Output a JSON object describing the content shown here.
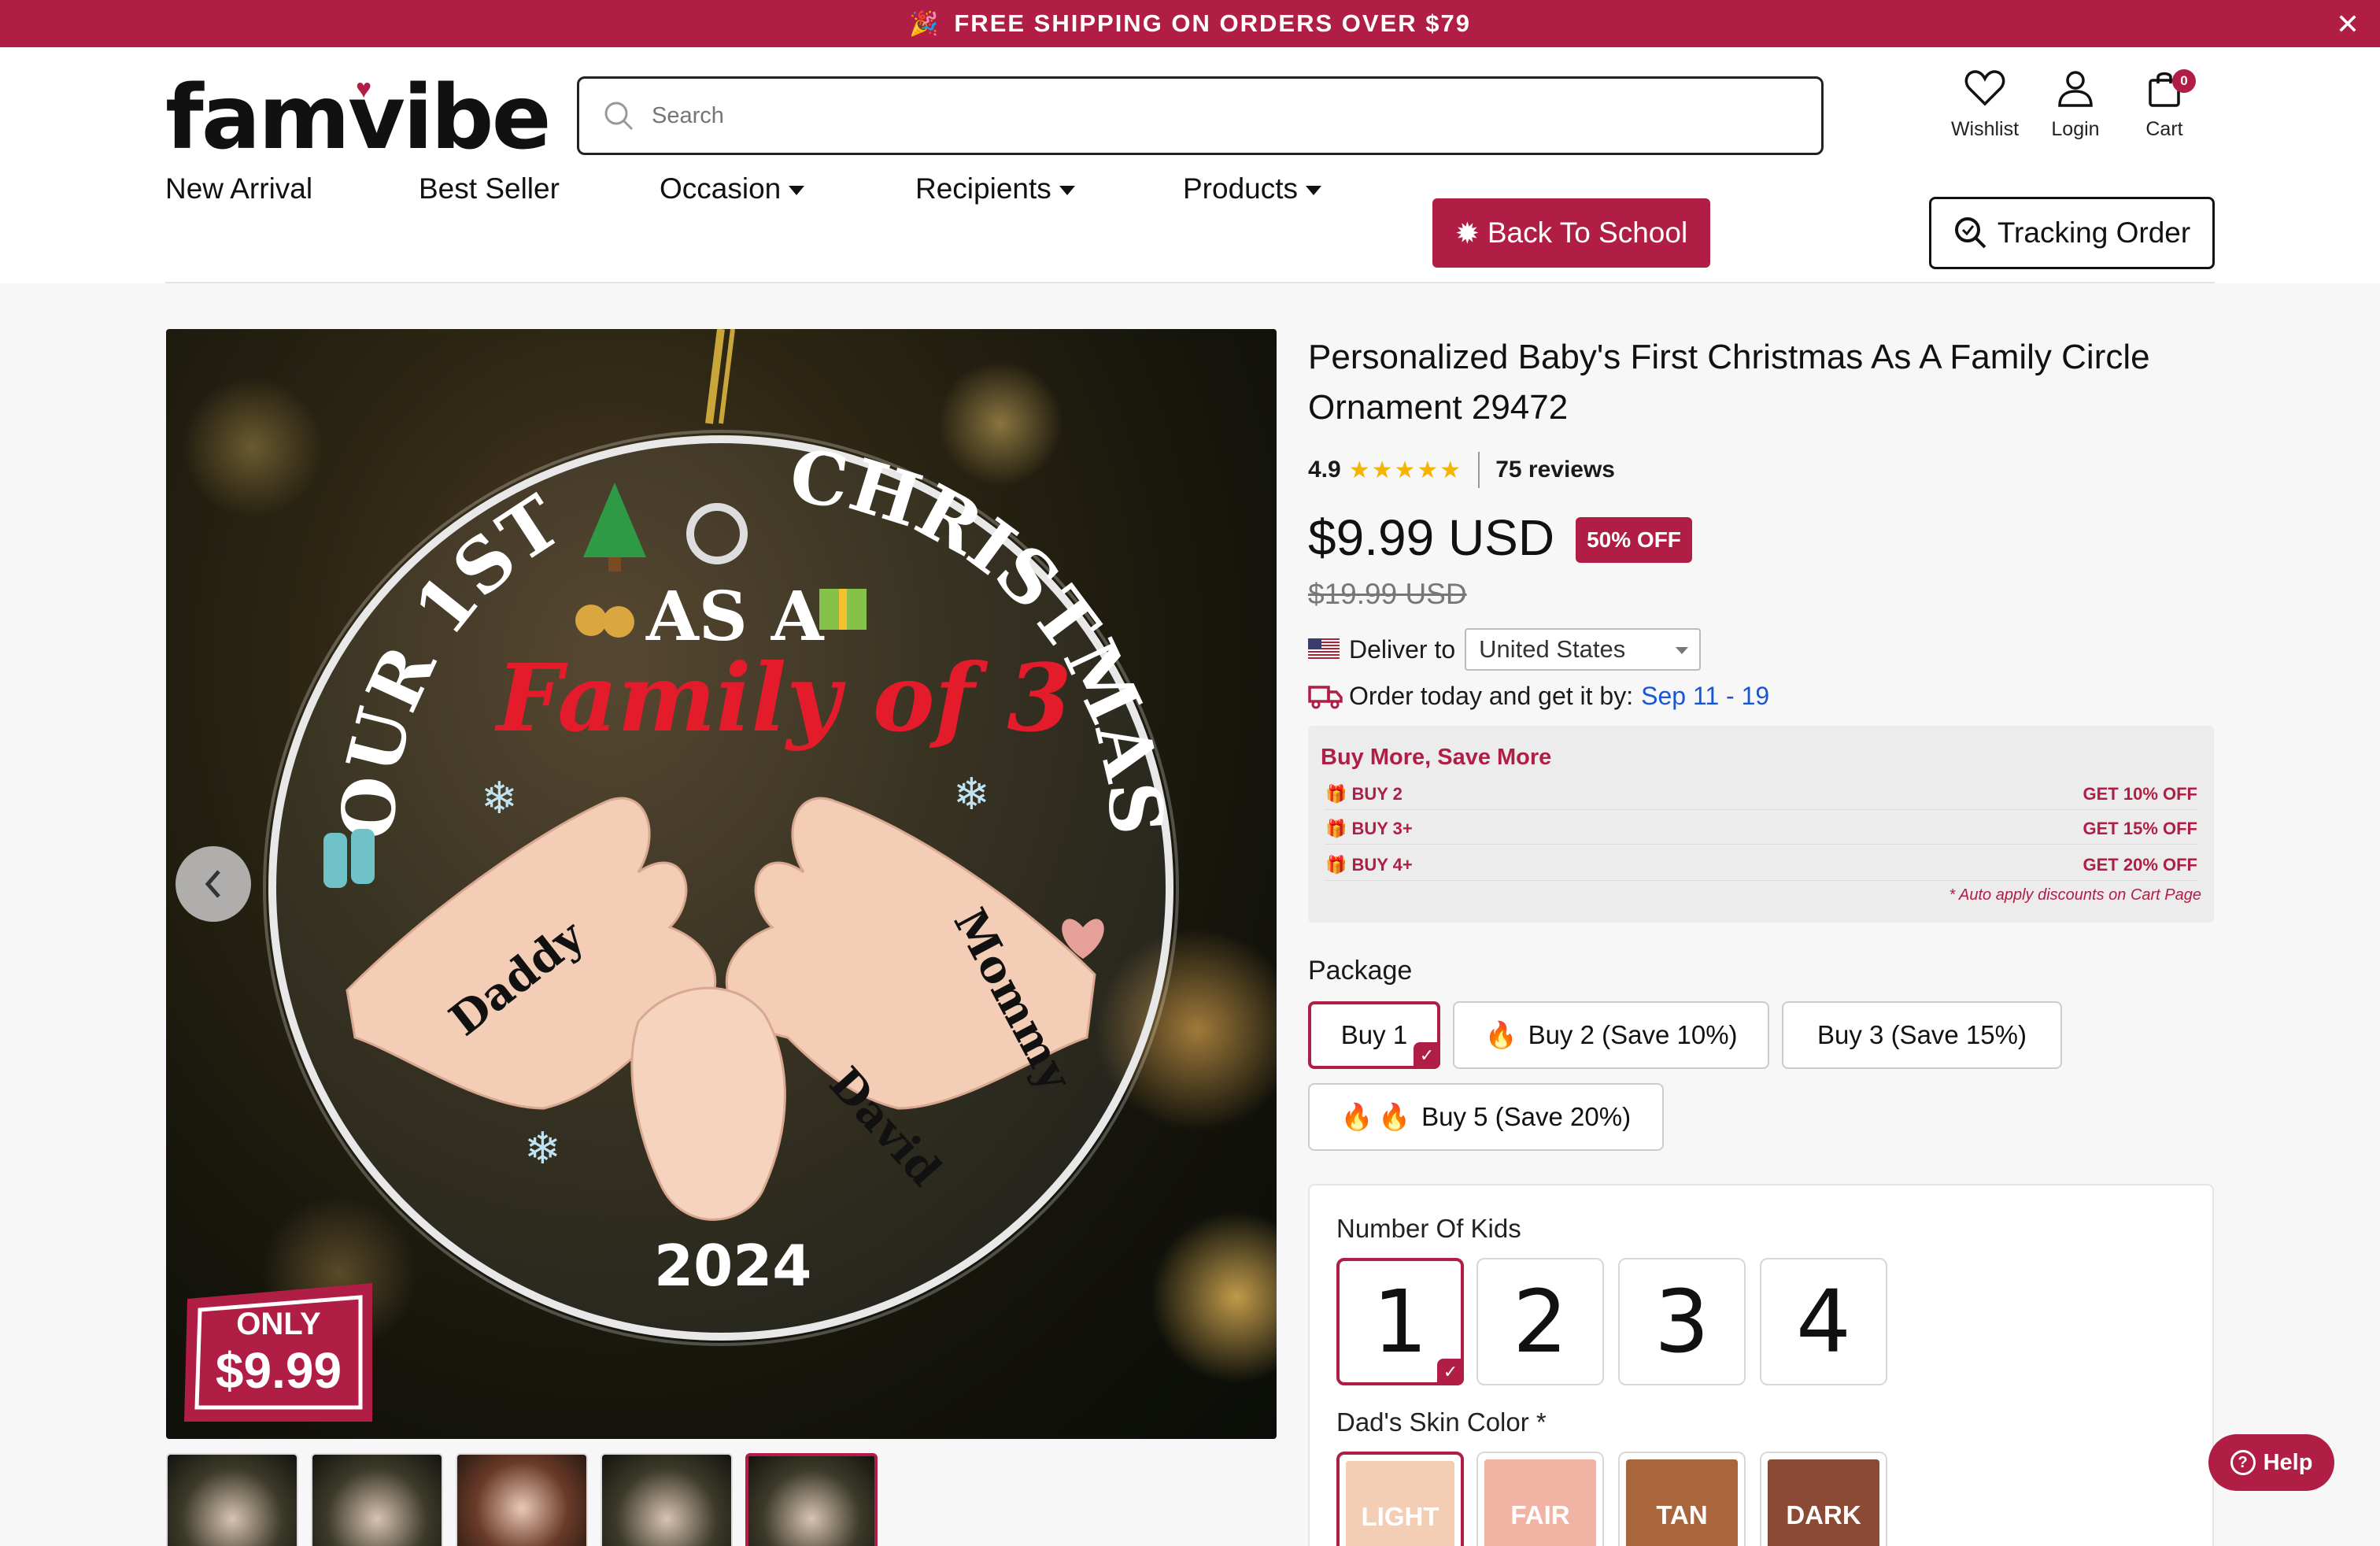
{
  "announcement": {
    "icon": "party-popper-icon",
    "text": "FREE SHIPPING ON ORDERS OVER $79",
    "close": "✕"
  },
  "header": {
    "logo": "famvibe",
    "search_placeholder": "Search",
    "icons": {
      "wishlist": "Wishlist",
      "login": "Login",
      "cart": "Cart",
      "cart_count": "0"
    }
  },
  "nav": {
    "items": [
      "New Arrival",
      "Best Seller",
      "Occasion",
      "Recipients",
      "Products"
    ],
    "back_to_school": "Back To School",
    "tracking": "Tracking Order"
  },
  "product": {
    "title": "Personalized Baby's First Christmas As A Family Circle Ornament 29472",
    "rating": "4.9",
    "stars": "★★★★★",
    "reviews": "75 reviews",
    "price": "$9.99 USD",
    "discount_badge": "50% OFF",
    "old_price": "$19.99 USD",
    "deliver_label": "Deliver to",
    "country": "United States",
    "order_text": "Order today and get it by:",
    "order_date": "Sep 11 - 19",
    "only_label": "ONLY",
    "only_price": "$9.99",
    "ornament": {
      "arc_text": "OUR 1ST AS A CHRISTMAS",
      "family_text": "Family of 3",
      "names": [
        "Daddy",
        "Mommy",
        "David"
      ],
      "year": "2024"
    }
  },
  "buy_more": {
    "title": "Buy More, Save More",
    "rows": [
      {
        "left": "BUY 2",
        "right": "GET 10% OFF"
      },
      {
        "left": "BUY 3+",
        "right": "GET 15% OFF"
      },
      {
        "left": "BUY 4+",
        "right": "GET 20% OFF"
      }
    ],
    "note": "* Auto apply discounts on Cart Page"
  },
  "package": {
    "label": "Package",
    "options": [
      "Buy 1",
      "Buy 2 (Save 10%)",
      "Buy 3 (Save 15%)",
      "Buy 5 (Save 20%)"
    ],
    "selected": "Buy 1"
  },
  "kids": {
    "label": "Number Of Kids",
    "options": [
      "1",
      "2",
      "3",
      "4"
    ],
    "selected": "1"
  },
  "skin": {
    "label": "Dad's Skin Color *",
    "options": [
      {
        "name": "LIGHT",
        "color": "#f4cdb5"
      },
      {
        "name": "FAIR",
        "color": "#f1b4a4"
      },
      {
        "name": "TAN",
        "color": "#a9663d"
      },
      {
        "name": "DARK",
        "color": "#8a4a36"
      }
    ],
    "selected": "LIGHT"
  },
  "help": "Help",
  "colors": {
    "brand": "#b01e45",
    "link": "#1a55d6",
    "star": "#f4b400"
  }
}
